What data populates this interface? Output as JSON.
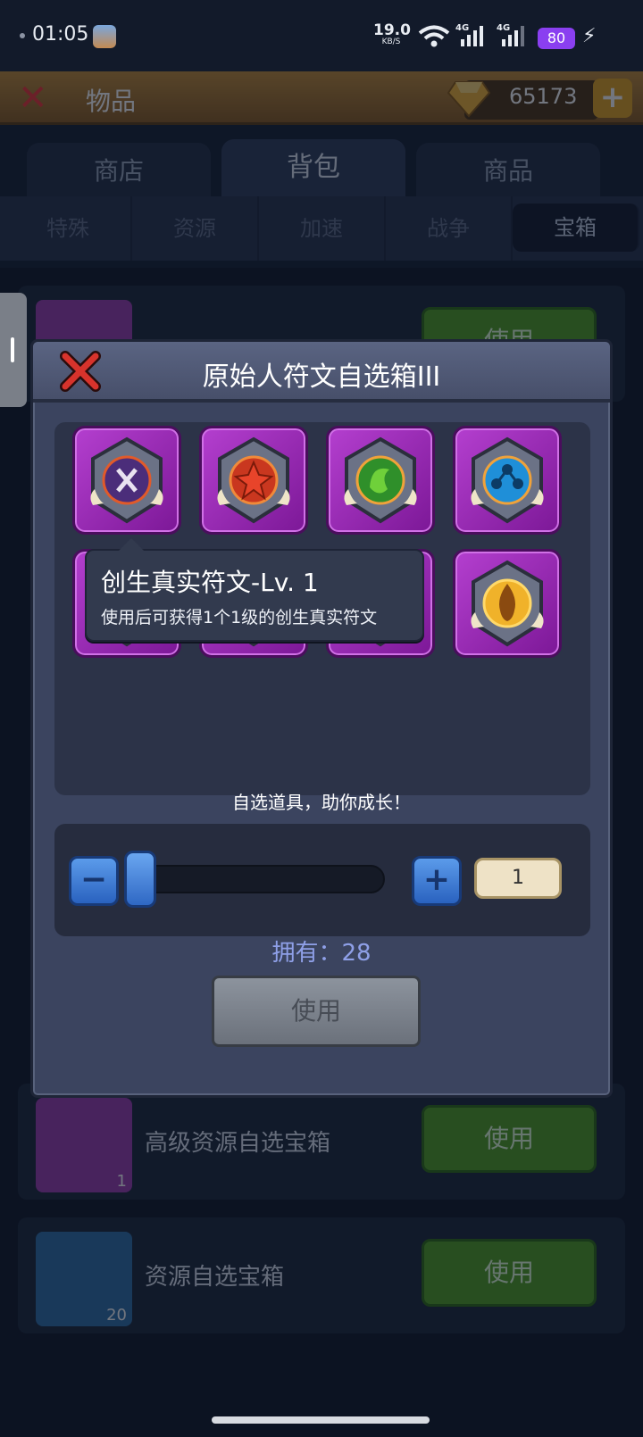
{
  "status_bar": {
    "time": "01:05",
    "net_speed": "19.0",
    "net_unit": "KB/S",
    "sig1_label": "4G",
    "sig2_label": "4G",
    "battery": "80"
  },
  "header": {
    "title": "物品",
    "gems": "65173"
  },
  "tabs": [
    "商店",
    "背包",
    "商品"
  ],
  "active_tab": "背包",
  "sub_tabs": [
    "特殊",
    "资源",
    "加速",
    "战争",
    "宝箱"
  ],
  "active_sub_tab": "宝箱",
  "list_items": [
    {
      "name": "高级资源自选宝箱",
      "count": "1",
      "button": "使用"
    },
    {
      "name": "资源自选宝箱",
      "count": "20",
      "button": "使用"
    }
  ],
  "top_row_button": "使用",
  "modal": {
    "title": "原始人符文自选箱III",
    "items": [
      {
        "icon": "purple-rune-icon"
      },
      {
        "icon": "red-star-rune-icon"
      },
      {
        "icon": "green-swirl-rune-icon"
      },
      {
        "icon": "blue-node-rune-icon"
      },
      {
        "icon": "rune-icon"
      },
      {
        "icon": "rune-icon"
      },
      {
        "icon": "rune-icon"
      },
      {
        "icon": "gold-flame-rune-icon"
      }
    ],
    "tooltip": {
      "title": "创生真实符文-Lv. 1",
      "description": "使用后可获得1个1级的创生真实符文"
    },
    "slogan": "自选道具，助你成长！",
    "quantity": "1",
    "slider_fraction": 0.0,
    "owned_label": "拥有：28",
    "use_button": "使用"
  },
  "colors": {
    "modal_bg": "#3b445f",
    "cell_purple": "#9a2cb8",
    "owned_text": "#8fa0e8",
    "battery": "#8a3ff0",
    "use_green": "#4fa11f"
  }
}
